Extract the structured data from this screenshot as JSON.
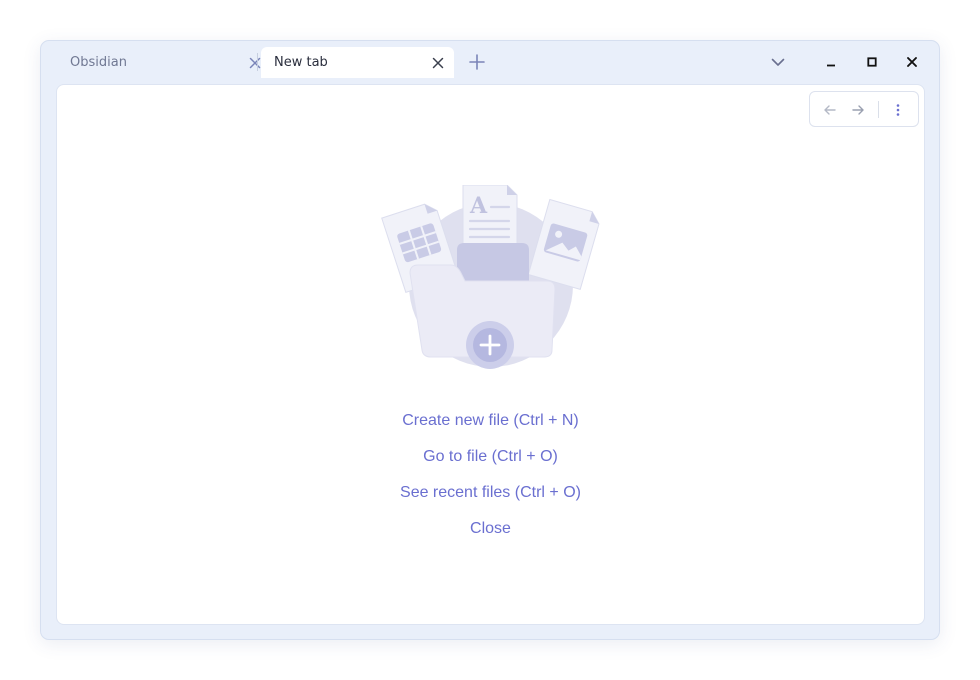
{
  "tabs": [
    {
      "label": "Obsidian",
      "active": false
    },
    {
      "label": "New tab",
      "active": true
    }
  ],
  "icons": {
    "tab_close": "close-icon",
    "new_tab": "plus-icon",
    "tab_list": "chevron-down-icon",
    "minimize": "minimize-icon",
    "maximize": "maximize-icon",
    "close_window": "close-icon",
    "back": "arrow-left-icon",
    "forward": "arrow-right-icon",
    "more": "more-vertical-icon"
  },
  "empty_state": {
    "actions": [
      {
        "label": "Create new file (Ctrl + N)"
      },
      {
        "label": "Go to file (Ctrl + O)"
      },
      {
        "label": "See recent files (Ctrl + O)"
      },
      {
        "label": "Close"
      }
    ]
  },
  "colors": {
    "accent": "#6a6fd0",
    "window_bg": "#e9effa",
    "illustration": "#c9cbe6"
  }
}
